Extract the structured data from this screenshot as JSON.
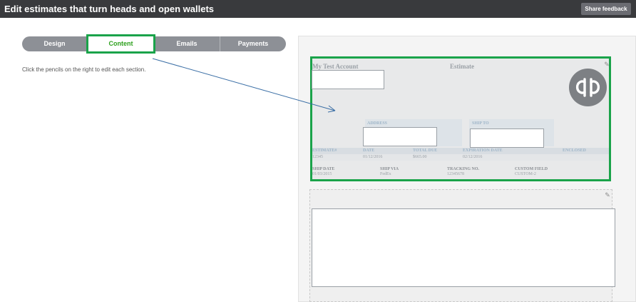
{
  "topbar": {
    "title": "Edit estimates that turn heads and open wallets",
    "feedback_label": "Share feedback"
  },
  "tabs": [
    "Design",
    "Content",
    "Emails",
    "Payments"
  ],
  "active_tab": "Content",
  "hint": "Click the pencils on the right to edit each section.",
  "estimate": {
    "account": "My Test Account",
    "doc_title": "Estimate",
    "address_label": "ADDRESS",
    "ship_to_label": "SHIP TO",
    "headers": [
      "ESTIMATE#",
      "DATE",
      "TOTAL DUE",
      "EXPIRATION DATE",
      "ENCLOSED"
    ],
    "values": [
      "12345",
      "01/12/2016",
      "$665.00",
      "02/12/2016"
    ],
    "ship_headers": [
      "SHIP DATE",
      "SHIP VIA",
      "TRACKING NO.",
      "CUSTOM FIELD"
    ],
    "ship_values": [
      "01/03/2015",
      "FedEx",
      "12345678",
      "CUSTOM-2"
    ]
  },
  "icons": {
    "pencil": "pencil-icon",
    "logo": "quickbooks-logo"
  },
  "colors": {
    "topbar": "#393a3d",
    "highlight": "#1aa34a",
    "active_tab_text": "#2ca01c",
    "arrow": "#3a6ea5"
  }
}
